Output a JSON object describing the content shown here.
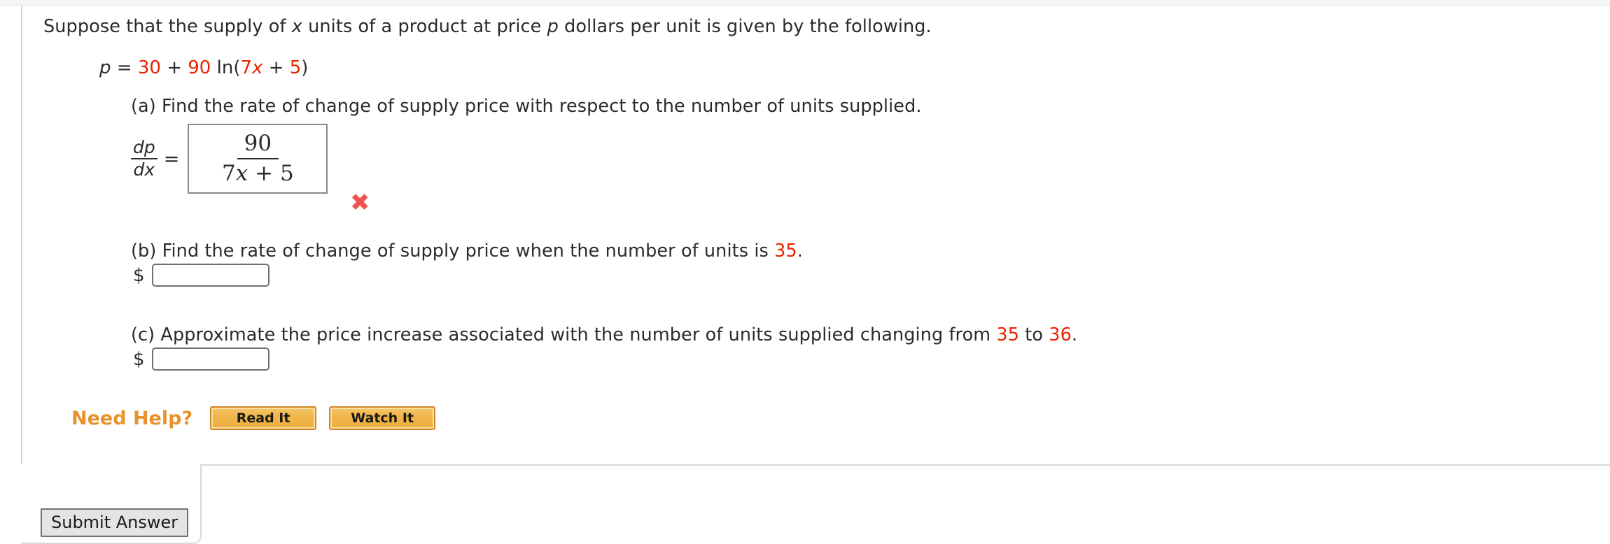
{
  "problem": {
    "stem_before_x": "Suppose that the supply of ",
    "stem_x": "x",
    "stem_mid": " units of a product at price ",
    "stem_p": "p",
    "stem_after": " dollars per unit is given by the following.",
    "equation": {
      "lhs": "p",
      "equals": "=",
      "const_term": "30",
      "plus": "+",
      "coefficient": "90",
      "ln": "ln(",
      "inner_coefficient": "7",
      "inner_var": "x",
      "inner_plus": "+",
      "inner_const": "5",
      "close": ")"
    }
  },
  "parts": {
    "a": {
      "label": "(a) Find the rate of change of supply price with respect to the number of units supplied.",
      "derivative_numerator": "dp",
      "derivative_denominator": "dx",
      "equals": "=",
      "answer_numerator": "90",
      "answer_denominator_coeff": "7",
      "answer_denominator_var": "x",
      "answer_denominator_plus": " + ",
      "answer_denominator_const": "5",
      "grade_mark": "✖",
      "grade_status": "incorrect"
    },
    "b": {
      "label_before": "(b) Find the rate of change of supply price when the number of units is ",
      "label_value": "35",
      "label_after": ".",
      "currency_symbol": "$",
      "input_value": "",
      "input_placeholder": ""
    },
    "c": {
      "label_before": "(c) Approximate the price increase associated with the number of units supplied changing from ",
      "label_value_from": "35",
      "label_mid": " to ",
      "label_value_to": "36",
      "label_after": ".",
      "currency_symbol": "$",
      "input_value": "",
      "input_placeholder": ""
    }
  },
  "help": {
    "label": "Need Help?",
    "read_button": "Read It",
    "watch_button": "Watch It"
  },
  "footer": {
    "submit_button": "Submit Answer"
  },
  "colors": {
    "red_value": "#ea2300",
    "incorrect_mark": "#ef5350",
    "help_label": "#e8922c",
    "help_button": "#f0b449",
    "text": "#2b2b2b"
  }
}
